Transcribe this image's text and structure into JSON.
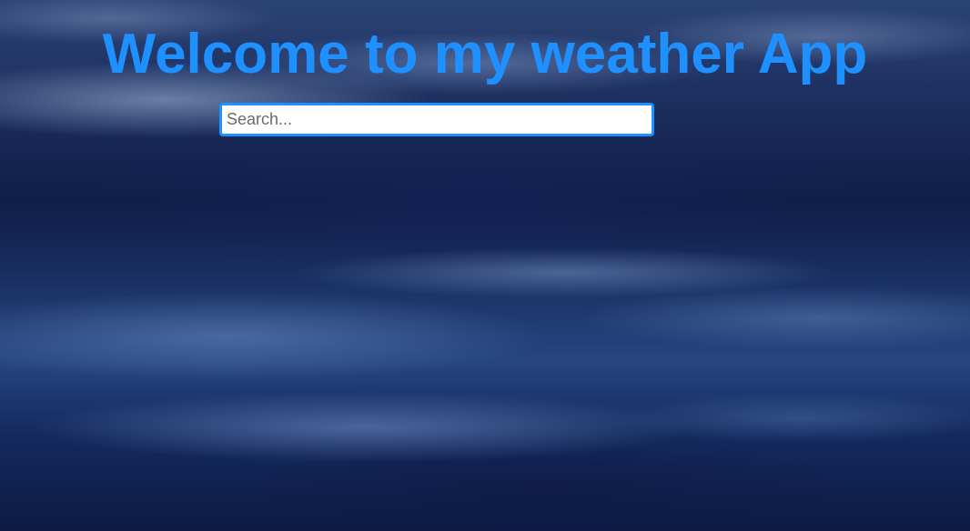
{
  "header": {
    "title": "Welcome to my weather App"
  },
  "search": {
    "placeholder": "Search...",
    "value": ""
  },
  "colors": {
    "accent": "#1e90ff",
    "input_background": "#ffffff"
  }
}
